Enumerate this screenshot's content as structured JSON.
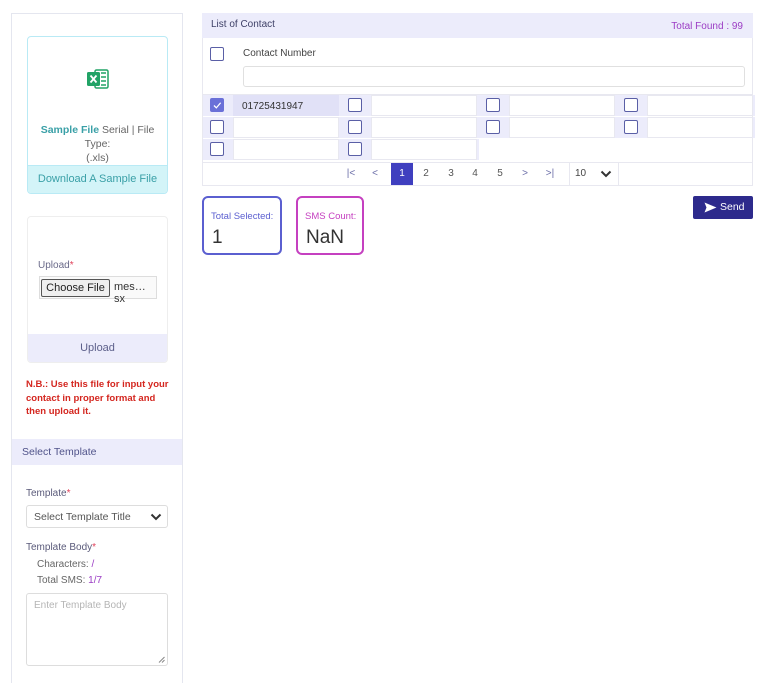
{
  "sidebar": {
    "sample": {
      "bold": "Sample File",
      "serial": " Serial | File Type:",
      "ext": "(.xls)",
      "download_label": "Download A Sample File"
    },
    "upload": {
      "label": "Upload",
      "required_mark": "*",
      "choose_label": "Choose File",
      "file_name": "mes…sx",
      "button_label": "Upload"
    },
    "note": "N.B.: Use this file for input your contact in proper format and then upload it.",
    "template": {
      "section_title": "Select Template",
      "label": "Template",
      "required_mark": "*",
      "select_value": "Select Template Title",
      "body_label": "Template Body",
      "characters_label": "Characters:",
      "characters_value": "/",
      "total_sms_label": "Total SMS:",
      "total_sms_value": "1/7",
      "body_placeholder": "Enter Template Body"
    }
  },
  "contacts": {
    "title": "List of Contact",
    "total_found": "Total Found : 99",
    "column_label": "Contact Number",
    "rows": [
      [
        "01725431947",
        "",
        "",
        ""
      ],
      [
        "",
        "",
        "",
        ""
      ],
      [
        "",
        ""
      ]
    ],
    "checked": [
      [
        true,
        false,
        false,
        false
      ],
      [
        false,
        false,
        false,
        false
      ],
      [
        false,
        false
      ]
    ]
  },
  "pagination": {
    "first": "|<",
    "prev": "<",
    "pages": [
      "1",
      "2",
      "3",
      "4",
      "5"
    ],
    "active_page": "1",
    "next": ">",
    "last": ">|",
    "page_size": "10"
  },
  "stats": {
    "total_selected_label": "Total Selected:",
    "total_selected_value": "1",
    "sms_count_label": "SMS Count:",
    "sms_count_value": "NaN"
  },
  "send_label": "Send",
  "colors": {
    "accent": "#2d2a8c",
    "primary_purple": "#5b5fd0",
    "magenta": "#c540c0",
    "teal": "#3aa0a7",
    "danger": "#d4261f"
  },
  "icons": {
    "excel": "excel-icon",
    "send": "send-icon",
    "chevron": "chevron-down-icon"
  }
}
